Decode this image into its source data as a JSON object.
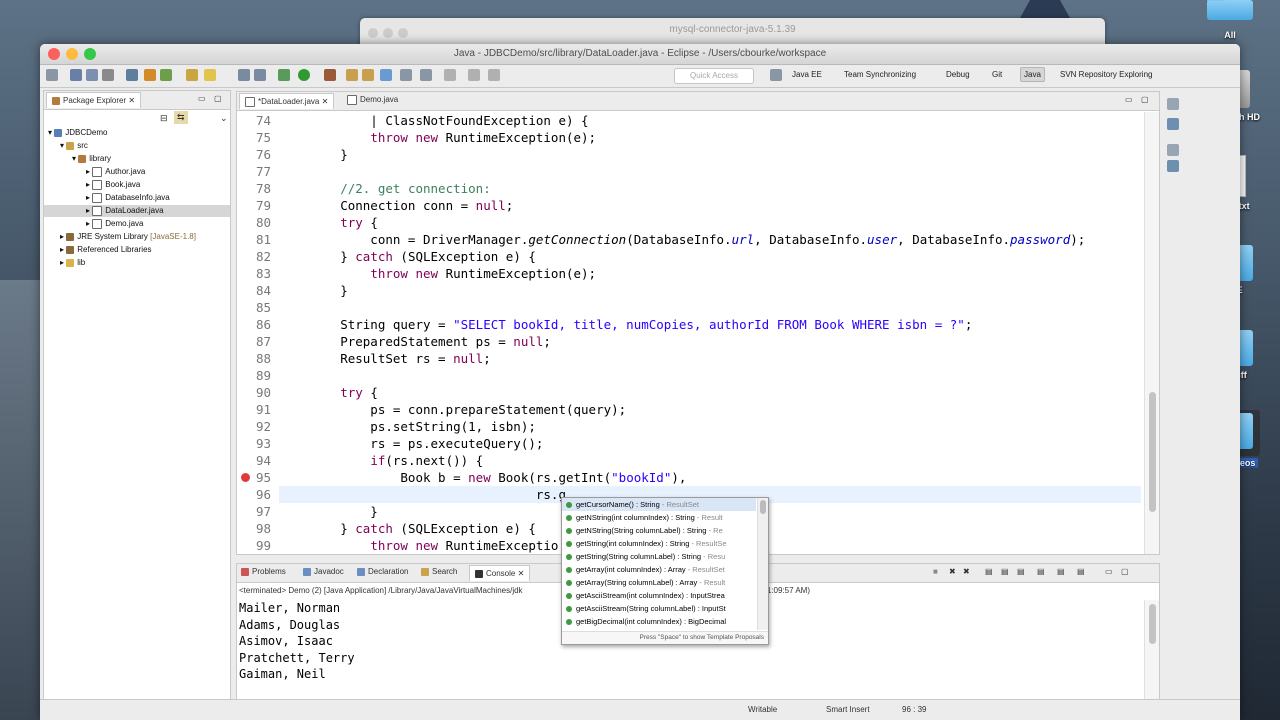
{
  "desktop": {
    "icons": [
      {
        "label": "All"
      },
      {
        "label": "Macintosh HD"
      },
      {
        "label": "TODO.txt",
        "file_type": "TXT"
      },
      {
        "label": "CSCE"
      },
      {
        "label": "myStuff"
      },
      {
        "label": "SQL-Videos"
      }
    ],
    "background_window_title": "mysql-connector-java-5.1.39"
  },
  "window": {
    "title": "Java - JDBCDemo/src/library/DataLoader.java - Eclipse - /Users/cbourke/workspace",
    "quick_access_placeholder": "Quick Access",
    "perspectives": [
      "Java EE",
      "Team Synchronizing",
      "Debug",
      "Git",
      "Java",
      "SVN Repository Exploring"
    ],
    "active_perspective": "Java"
  },
  "package_explorer": {
    "tab_label": "Package Explorer",
    "tree": [
      {
        "label": "JDBCDemo",
        "depth": 0
      },
      {
        "label": "src",
        "depth": 1
      },
      {
        "label": "library",
        "depth": 2
      },
      {
        "label": "Author.java",
        "depth": 3
      },
      {
        "label": "Book.java",
        "depth": 3
      },
      {
        "label": "DatabaseInfo.java",
        "depth": 3
      },
      {
        "label": "DataLoader.java",
        "depth": 3,
        "selected": true
      },
      {
        "label": "Demo.java",
        "depth": 3
      },
      {
        "label": "JRE System Library",
        "suffix": "[JavaSE-1.8]",
        "depth": 1
      },
      {
        "label": "Referenced Libraries",
        "depth": 1
      },
      {
        "label": "lib",
        "depth": 1
      }
    ]
  },
  "editor": {
    "tabs": [
      "*DataLoader.java",
      "Demo.java"
    ],
    "active_tab": "*DataLoader.java",
    "error_line": "95",
    "current_line": "96",
    "lines": [
      {
        "n": "74",
        "segs": [
          {
            "t": "            | ClassNotFoundException e) {"
          }
        ]
      },
      {
        "n": "75",
        "segs": [
          {
            "t": "            "
          },
          {
            "t": "throw new",
            "c": "kw"
          },
          {
            "t": " RuntimeException(e);"
          }
        ]
      },
      {
        "n": "76",
        "segs": [
          {
            "t": "        }"
          }
        ]
      },
      {
        "n": "77",
        "segs": [
          {
            "t": ""
          }
        ]
      },
      {
        "n": "78",
        "segs": [
          {
            "t": "        "
          },
          {
            "t": "//2. get connection:",
            "c": "cm"
          }
        ]
      },
      {
        "n": "79",
        "segs": [
          {
            "t": "        Connection conn = "
          },
          {
            "t": "null",
            "c": "kw"
          },
          {
            "t": ";"
          }
        ]
      },
      {
        "n": "80",
        "segs": [
          {
            "t": "        "
          },
          {
            "t": "try",
            "c": "kw"
          },
          {
            "t": " {"
          }
        ]
      },
      {
        "n": "81",
        "segs": [
          {
            "t": "            conn = DriverManager."
          },
          {
            "t": "getConnection",
            "c": "it"
          },
          {
            "t": "(DatabaseInfo."
          },
          {
            "t": "url",
            "c": "fld"
          },
          {
            "t": ", DatabaseInfo."
          },
          {
            "t": "user",
            "c": "fld"
          },
          {
            "t": ", DatabaseInfo."
          },
          {
            "t": "password",
            "c": "fld"
          },
          {
            "t": ");"
          }
        ]
      },
      {
        "n": "82",
        "segs": [
          {
            "t": "        } "
          },
          {
            "t": "catch",
            "c": "kw"
          },
          {
            "t": " (SQLException e) {"
          }
        ]
      },
      {
        "n": "83",
        "segs": [
          {
            "t": "            "
          },
          {
            "t": "throw new",
            "c": "kw"
          },
          {
            "t": " RuntimeException(e);"
          }
        ]
      },
      {
        "n": "84",
        "segs": [
          {
            "t": "        }"
          }
        ]
      },
      {
        "n": "85",
        "segs": [
          {
            "t": ""
          }
        ]
      },
      {
        "n": "86",
        "segs": [
          {
            "t": "        String query = "
          },
          {
            "t": "\"SELECT bookId, title, numCopies, authorId FROM Book WHERE isbn = ?\"",
            "c": "str"
          },
          {
            "t": ";"
          }
        ]
      },
      {
        "n": "87",
        "segs": [
          {
            "t": "        PreparedStatement ps = "
          },
          {
            "t": "null",
            "c": "kw"
          },
          {
            "t": ";"
          }
        ]
      },
      {
        "n": "88",
        "segs": [
          {
            "t": "        ResultSet rs = "
          },
          {
            "t": "null",
            "c": "kw"
          },
          {
            "t": ";"
          }
        ]
      },
      {
        "n": "89",
        "segs": [
          {
            "t": ""
          }
        ]
      },
      {
        "n": "90",
        "segs": [
          {
            "t": "        "
          },
          {
            "t": "try",
            "c": "kw"
          },
          {
            "t": " {"
          }
        ]
      },
      {
        "n": "91",
        "segs": [
          {
            "t": "            ps = conn.prepareStatement(query);"
          }
        ]
      },
      {
        "n": "92",
        "segs": [
          {
            "t": "            ps.setString(1, isbn);"
          }
        ]
      },
      {
        "n": "93",
        "segs": [
          {
            "t": "            rs = ps.executeQuery();"
          }
        ]
      },
      {
        "n": "94",
        "segs": [
          {
            "t": "            "
          },
          {
            "t": "if",
            "c": "kw"
          },
          {
            "t": "(rs.next()) {"
          }
        ]
      },
      {
        "n": "95",
        "segs": [
          {
            "t": "                Book b = "
          },
          {
            "t": "new",
            "c": "kw"
          },
          {
            "t": " Book(rs.getInt("
          },
          {
            "t": "\"bookId\"",
            "c": "str"
          },
          {
            "t": "),"
          }
        ]
      },
      {
        "n": "96",
        "segs": [
          {
            "t": "                                  rs.g"
          }
        ]
      },
      {
        "n": "97",
        "segs": [
          {
            "t": "            }"
          }
        ]
      },
      {
        "n": "98",
        "segs": [
          {
            "t": "        } "
          },
          {
            "t": "catch",
            "c": "kw"
          },
          {
            "t": " (SQLException e) {"
          }
        ]
      },
      {
        "n": "99",
        "segs": [
          {
            "t": "            "
          },
          {
            "t": "throw new",
            "c": "kw"
          },
          {
            "t": " RuntimeExceptio"
          }
        ]
      }
    ]
  },
  "autocomplete": {
    "items": [
      {
        "name": "getCursorName() : String",
        "type": " - ResultSet"
      },
      {
        "name": "getNString(int columnIndex) : String",
        "type": " - Result"
      },
      {
        "name": "getNString(String columnLabel) : String",
        "type": " - Re"
      },
      {
        "name": "getString(int columnIndex) : String",
        "type": " - ResultSe"
      },
      {
        "name": "getString(String columnLabel) : String",
        "type": " - Resu"
      },
      {
        "name": "getArray(int columnIndex) : Array",
        "type": " - ResultSet"
      },
      {
        "name": "getArray(String columnLabel) : Array",
        "type": " - Result"
      },
      {
        "name": "getAsciiStream(int columnIndex) : InputStrea",
        "type": ""
      },
      {
        "name": "getAsciiStream(String columnLabel) : InputSt",
        "type": ""
      },
      {
        "name": "getBigDecimal(int columnIndex) : BigDecimal",
        "type": ""
      }
    ],
    "footer": "Press \"Space\" to show Template Proposals"
  },
  "bottom_panel": {
    "tabs": [
      "Problems",
      "Javadoc",
      "Declaration",
      "Search",
      "Console"
    ],
    "active_tab": "Console",
    "launch_info": "<terminated> Demo (2) [Java Application] /Library/Java/JavaVirtualMachines/jdk",
    "launch_time": ", 11:09:57 AM)",
    "output": [
      "Mailer, Norman",
      "Adams, Douglas",
      "Asimov, Isaac",
      "Pratchett, Terry",
      "Gaiman, Neil"
    ]
  },
  "status_bar": {
    "writable": "Writable",
    "insert_mode": "Smart Insert",
    "position": "96 : 39"
  }
}
